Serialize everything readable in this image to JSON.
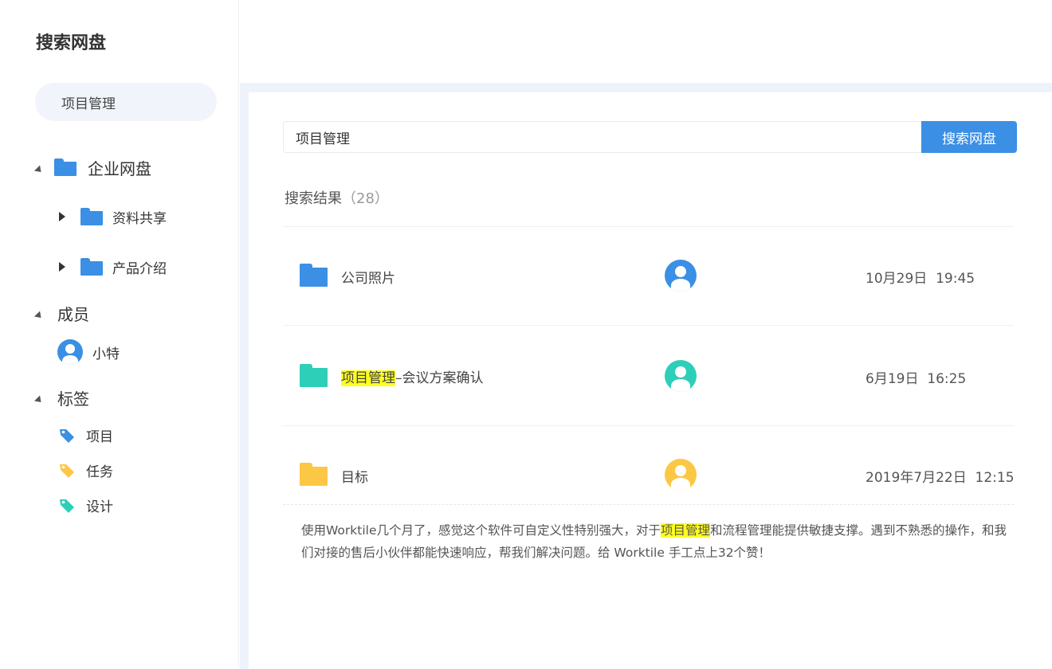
{
  "sidebar": {
    "title": "搜索网盘",
    "search_value": "项目管理",
    "tree": {
      "root_label": "企业网盘",
      "children": [
        {
          "label": "资料共享"
        },
        {
          "label": "产品介绍"
        }
      ]
    },
    "members": {
      "label": "成员",
      "items": [
        {
          "name": "小特"
        }
      ]
    },
    "tags": {
      "label": "标签",
      "items": [
        {
          "label": "项目",
          "color": "#3b8fe4"
        },
        {
          "label": "任务",
          "color": "#fcc745"
        },
        {
          "label": "设计",
          "color": "#2dcfb8"
        }
      ]
    }
  },
  "main": {
    "search": {
      "value": "项目管理",
      "button_label": "搜索网盘"
    },
    "results": {
      "heading": "搜索结果",
      "count": "（28）",
      "rows": [
        {
          "name": "公司照片",
          "highlight": "",
          "rest": "公司照片",
          "date": "10月29日",
          "time": "19:45",
          "folder_color": "#3b8fe4",
          "avatar_color": "#3b8fe4"
        },
        {
          "name": "项目管理–会议方案确认",
          "highlight": "项目管理",
          "rest": "–会议方案确认",
          "date": "6月19日",
          "time": "16:25",
          "folder_color": "#2dcfb8",
          "avatar_color": "#2dcfb8"
        },
        {
          "name": "目标",
          "highlight": "",
          "rest": "目标",
          "date": "2019年7月22日",
          "time": "12:15",
          "folder_color": "#fcc745",
          "avatar_color": "#fcc745"
        }
      ],
      "comment": {
        "before": "使用Worktile几个月了，感觉这个软件可自定义性特别强大，对于",
        "highlight": "项目管理",
        "after": "和流程管理能提供敏捷支撑。遇到不熟悉的操作，和我们对接的售后小伙伴都能快速响应，帮我们解决问题。给 Worktile 手工点上32个赞！"
      }
    }
  },
  "colors": {
    "accent": "#3b8fe4",
    "highlight": "#ffff1e",
    "teal": "#2dcfb8",
    "yellow": "#fcc745"
  }
}
